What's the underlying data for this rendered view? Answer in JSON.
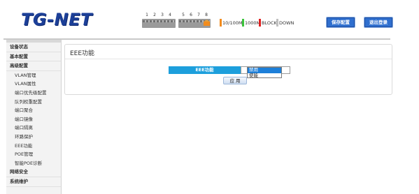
{
  "header": {
    "logo": "TG-NET",
    "ports": [
      "1",
      "2",
      "3",
      "4",
      "5",
      "6",
      "7",
      "8"
    ],
    "legend": [
      {
        "label": "10/100M",
        "color": "#f28c1e"
      },
      {
        "label": "1000M",
        "color": "#3cc43c"
      },
      {
        "label": "BLOCK",
        "color": "#e02020"
      },
      {
        "label": "DOWN",
        "color": "#c0c0c0"
      }
    ],
    "save_label": "保存配置",
    "logout_label": "退出登录"
  },
  "sidebar": {
    "items": [
      {
        "label": "设备状态"
      },
      {
        "label": "基本配置"
      },
      {
        "label": "高级配置"
      },
      {
        "label": "VLAN管理"
      },
      {
        "label": "VLAN属性"
      },
      {
        "label": "端口优先级配置"
      },
      {
        "label": "队列权重配置"
      },
      {
        "label": "端口聚合"
      },
      {
        "label": "端口镜像"
      },
      {
        "label": "端口隔离"
      },
      {
        "label": "环路保护"
      },
      {
        "label": "EEE功能"
      },
      {
        "label": "POE管理"
      },
      {
        "label": "智能POE诊断"
      },
      {
        "label": "网络安全"
      },
      {
        "label": "系统维护"
      }
    ]
  },
  "main": {
    "title": "EEE功能",
    "field_label": "EEE功能",
    "options": [
      "禁用",
      "使能"
    ],
    "selected": "禁用",
    "apply_label": "应 用"
  }
}
